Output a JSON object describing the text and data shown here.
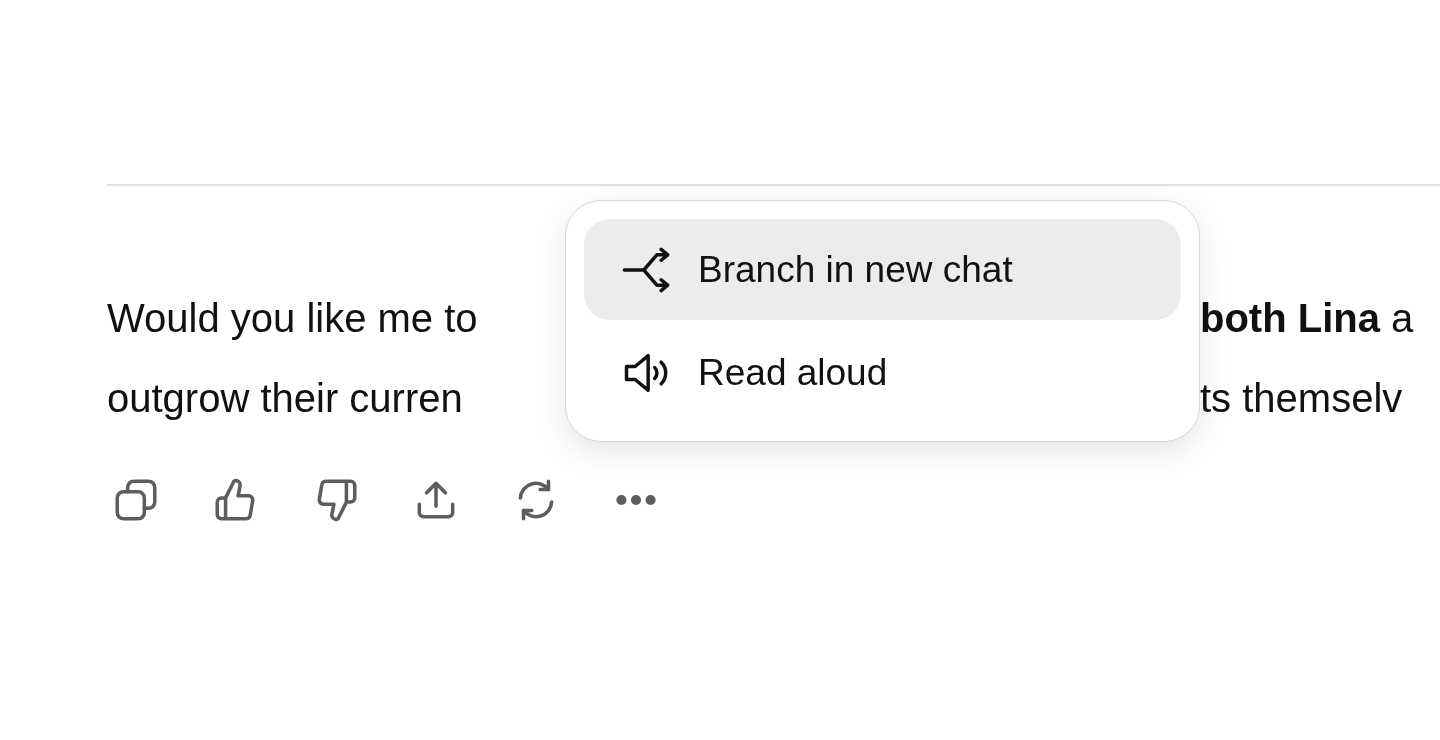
{
  "message": {
    "lines": [
      {
        "left": "Would you like me to",
        "right": "**both Lina** a"
      },
      {
        "left": "outgrow their curren",
        "right": "ts themselv"
      }
    ]
  },
  "actions": [
    {
      "kind": "copy"
    },
    {
      "kind": "like"
    },
    {
      "kind": "dislike"
    },
    {
      "kind": "share"
    },
    {
      "kind": "retry"
    },
    {
      "kind": "more"
    }
  ],
  "menu": {
    "items": [
      {
        "label": "Branch in new chat",
        "kind": "branch",
        "selected": true
      },
      {
        "label": "Read aloud",
        "kind": "speaker",
        "selected": false
      }
    ]
  }
}
